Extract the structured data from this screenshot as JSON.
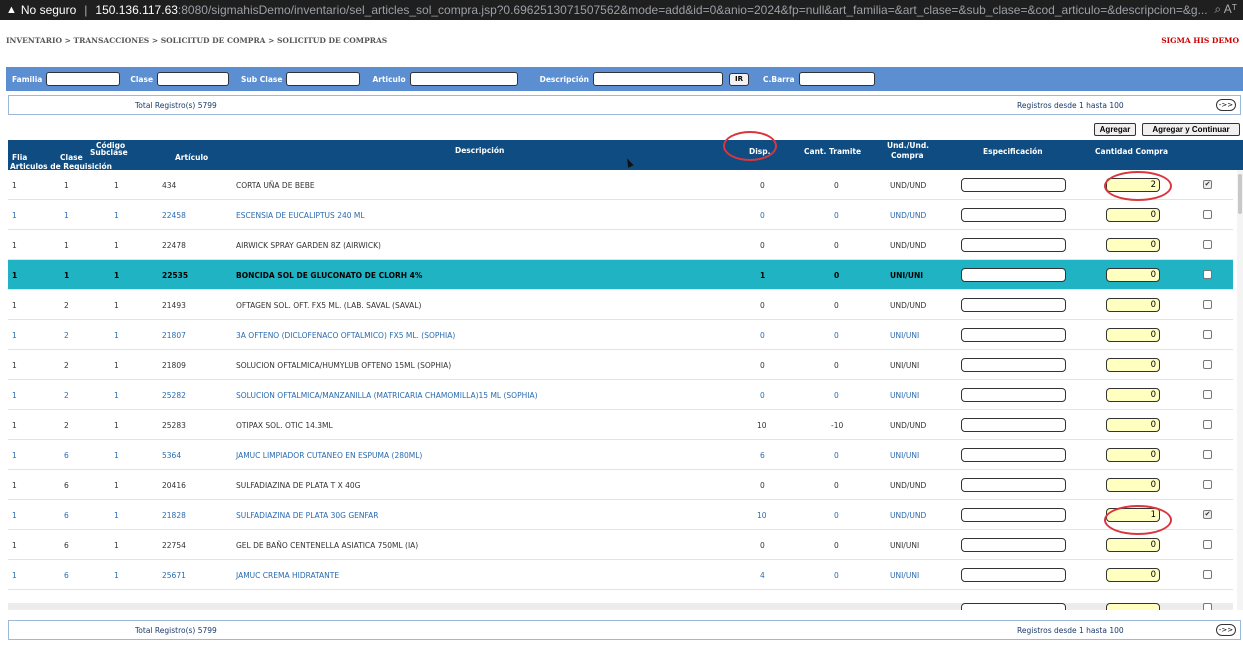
{
  "browser": {
    "security_label": "No seguro",
    "url_host": "150.136.117.63",
    "url_path": ":8080/sigmahisDemo/inventario/sel_articles_sol_compra.jsp?0.6962513071507562&mode=add&id=0&anio=2024&fp=null&art_familia=&art_clase=&sub_clase=&cod_articulo=&descripcion=&g...",
    "right_icons": "⌕  Aᵀ"
  },
  "breadcrumb": "INVENTARIO > TRANSACCIONES > SOLICITUD DE COMPRA > SOLICITUD DE COMPRAS",
  "brand": "SIGMA HIS DEMO",
  "filters": {
    "familia": "Familia",
    "clase": "Clase",
    "subclase": "Sub Clase",
    "articulo": "Articulo",
    "descripcion": "Descripción",
    "ir": "IR",
    "cbarra": "C.Barra"
  },
  "pager": {
    "total": "Total Registro(s) 5799",
    "range": "Registros desde 1 hasta 100",
    "next": "->>"
  },
  "actions": {
    "agregar": "Agregar",
    "agregar_continuar": "Agregar y Continuar"
  },
  "headers": {
    "flia": "Flia",
    "clase": "Clase",
    "codigo": "Código",
    "subclase": "Subclase",
    "articulo": "Artículo",
    "articulos_req": "Articulos de Requisición",
    "descripcion": "Descripción",
    "disp": "Disp.",
    "cant_tramite": "Cant. Tramite",
    "und": "Und./Und.",
    "compra": "Compra",
    "especificacion": "Especificación",
    "cantidad_compra": "Cantidad Compra"
  },
  "rows": [
    {
      "flia": "1",
      "clase": "1",
      "sub": "1",
      "art": "434",
      "desc": "CORTA UÑA DE BEBE",
      "disp": "0",
      "tram": "0",
      "und": "UND/UND",
      "qty": "2",
      "checked": true
    },
    {
      "flia": "1",
      "clase": "1",
      "sub": "1",
      "art": "22458",
      "desc": "ESCENSIA DE EUCALIPTUS 240 ML",
      "disp": "0",
      "tram": "0",
      "und": "UND/UND",
      "qty": "0",
      "checked": false
    },
    {
      "flia": "1",
      "clase": "1",
      "sub": "1",
      "art": "22478",
      "desc": "AIRWICK SPRAY GARDEN 8Z (AIRWICK)",
      "disp": "0",
      "tram": "0",
      "und": "UND/UND",
      "qty": "0",
      "checked": false
    },
    {
      "flia": "1",
      "clase": "1",
      "sub": "1",
      "art": "22535",
      "desc": "BONCIDA SOL DE GLUCONATO DE CLORH 4%",
      "disp": "1",
      "tram": "0",
      "und": "UNI/UNI",
      "qty": "0",
      "checked": false
    },
    {
      "flia": "1",
      "clase": "2",
      "sub": "1",
      "art": "21493",
      "desc": "OFTAGEN SOL. OFT. FX5 ML. (LAB. SAVAL (SAVAL)",
      "disp": "0",
      "tram": "0",
      "und": "UND/UND",
      "qty": "0",
      "checked": false
    },
    {
      "flia": "1",
      "clase": "2",
      "sub": "1",
      "art": "21807",
      "desc": "3A OFTENO (DICLOFENACO OFTALMICO) FX5 ML. (SOPHIA)",
      "disp": "0",
      "tram": "0",
      "und": "UNI/UNI",
      "qty": "0",
      "checked": false
    },
    {
      "flia": "1",
      "clase": "2",
      "sub": "1",
      "art": "21809",
      "desc": "SOLUCION OFTALMICA/HUMYLUB OFTENO 15ML (SOPHIA)",
      "disp": "0",
      "tram": "0",
      "und": "UNI/UNI",
      "qty": "0",
      "checked": false
    },
    {
      "flia": "1",
      "clase": "2",
      "sub": "1",
      "art": "25282",
      "desc": "SOLUCION OFTALMICA/MANZANILLA (MATRICARIA CHAMOMILLA)15 ML (SOPHIA)",
      "disp": "0",
      "tram": "0",
      "und": "UNI/UNI",
      "qty": "0",
      "checked": false
    },
    {
      "flia": "1",
      "clase": "2",
      "sub": "1",
      "art": "25283",
      "desc": "OTIPAX SOL. OTIC 14.3ML",
      "disp": "10",
      "tram": "-10",
      "und": "UND/UND",
      "qty": "0",
      "checked": false
    },
    {
      "flia": "1",
      "clase": "6",
      "sub": "1",
      "art": "5364",
      "desc": "JAMUC LIMPIADOR CUTANEO EN ESPUMA (280ML)",
      "disp": "6",
      "tram": "0",
      "und": "UNI/UNI",
      "qty": "0",
      "checked": false
    },
    {
      "flia": "1",
      "clase": "6",
      "sub": "1",
      "art": "20416",
      "desc": "SULFADIAZINA DE PLATA T X 40G",
      "disp": "0",
      "tram": "0",
      "und": "UND/UND",
      "qty": "0",
      "checked": false
    },
    {
      "flia": "1",
      "clase": "6",
      "sub": "1",
      "art": "21828",
      "desc": "SULFADIAZINA DE PLATA 30G GENFAR",
      "disp": "10",
      "tram": "0",
      "und": "UND/UND",
      "qty": "1",
      "checked": true
    },
    {
      "flia": "1",
      "clase": "6",
      "sub": "1",
      "art": "22754",
      "desc": "GEL DE BAÑO CENTENELLA ASIATICA 750ML (IA)",
      "disp": "0",
      "tram": "0",
      "und": "UNI/UNI",
      "qty": "0",
      "checked": false
    },
    {
      "flia": "1",
      "clase": "6",
      "sub": "1",
      "art": "25671",
      "desc": "JAMUC CREMA HIDRATANTE",
      "disp": "4",
      "tram": "0",
      "und": "UNI/UNI",
      "qty": "0",
      "checked": false
    }
  ],
  "row_styles": [
    "plain",
    "link",
    "plain",
    "sel",
    "plain",
    "link",
    "plain",
    "link",
    "plain",
    "link",
    "plain",
    "link",
    "plain",
    "link"
  ],
  "colors": {
    "header": "#0f4c81",
    "filterbar": "#5b8fd1",
    "selected_row": "#1fb3c3",
    "qty_bg": "#ffffc0",
    "annotation": "#d9363e",
    "brand": "#cc0000"
  }
}
